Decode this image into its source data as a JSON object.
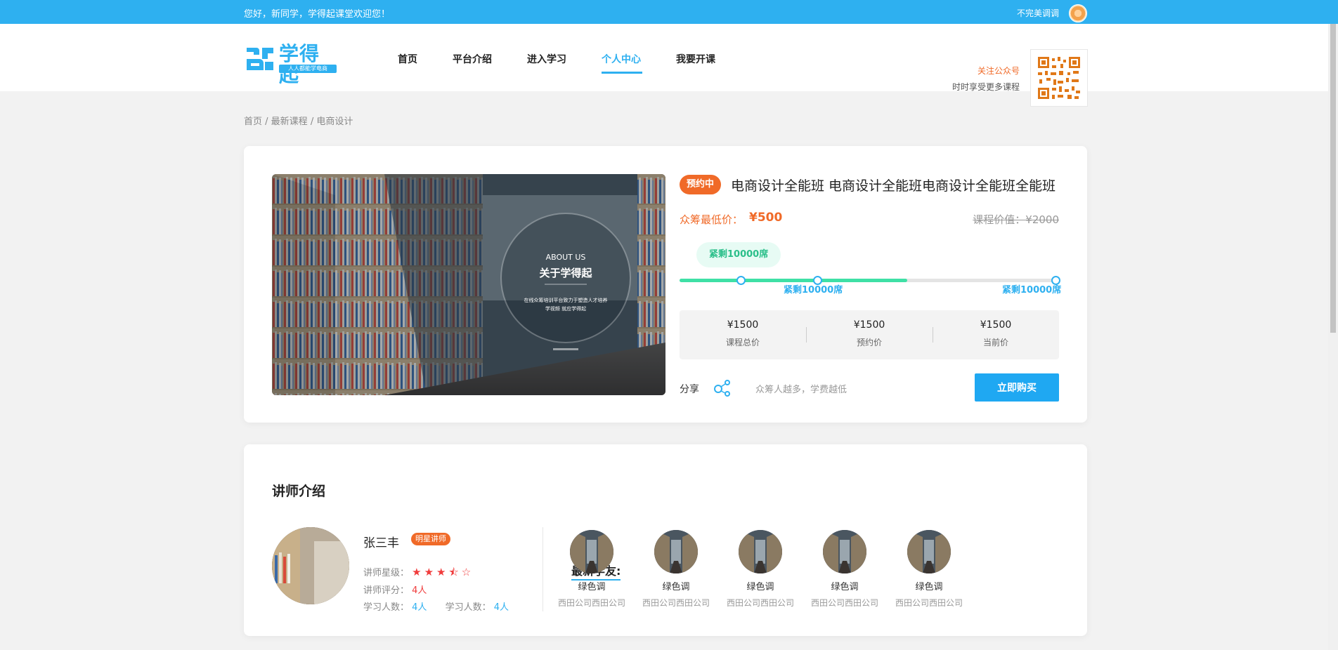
{
  "topbar": {
    "welcome": "您好，新同学，学得起课堂欢迎您！",
    "right_link": "不完美调调"
  },
  "logo": {
    "brand": "学得起",
    "slogan": "人人都能学电商"
  },
  "nav": {
    "items": [
      {
        "label": "首页"
      },
      {
        "label": "平台介绍"
      },
      {
        "label": "进入学习"
      },
      {
        "label": "个人中心"
      },
      {
        "label": "我要开课"
      }
    ],
    "active": "个人中心"
  },
  "follow": {
    "title": "关注公众号",
    "subtitle": "时时享受更多课程"
  },
  "breadcrumb": [
    "首页",
    "最新课程",
    "电商设计"
  ],
  "course": {
    "status_badge": "预约中",
    "title": "电商设计全能班 电商设计全能班电商设计全能班全能班",
    "min_price_label": "众筹最低价：",
    "min_price": "¥500",
    "original_price": "课程价值：¥2000",
    "bubble": "紧剩10000席",
    "progress_fraction": 0.6,
    "steps": [
      "紧剩10000席",
      "紧剩10000席"
    ],
    "prices": [
      {
        "value": "¥1500",
        "label": "课程总价"
      },
      {
        "value": "¥1500",
        "label": "预约价"
      },
      {
        "value": "¥1500",
        "label": "当前价"
      }
    ],
    "share_label": "分享",
    "tip": "众筹人越多，学费越低",
    "buy_button": "立即购买",
    "hero": {
      "about_en": "ABOUT  US",
      "about_cn": "关于学得起",
      "desc1": "在线众筹培训平台致力于塑造人才培养",
      "desc2": "学视频 就应学得起"
    }
  },
  "teacher": {
    "section_title": "讲师介绍",
    "name": "张三丰",
    "badge": "明星讲师",
    "rating_label": "讲师星级：",
    "rating_stars": 3.5,
    "score_label": "讲师评分：",
    "score": "4人",
    "learners_label": "学习人数：",
    "learners": "4人",
    "learners_label2": "学习人数：",
    "learners2": "4人"
  },
  "classmates": {
    "label": "最新学友:",
    "items": [
      {
        "name": "绿色调",
        "company": "西田公司西田公司"
      },
      {
        "name": "绿色调",
        "company": "西田公司西田公司"
      },
      {
        "name": "绿色调",
        "company": "西田公司西田公司"
      },
      {
        "name": "绿色调",
        "company": "西田公司西田公司"
      },
      {
        "name": "绿色调",
        "company": "西田公司西田公司"
      }
    ]
  },
  "colors": {
    "primary": "#2eb0f0",
    "accent": "#f06a28",
    "progress": "#3fe0a6"
  }
}
